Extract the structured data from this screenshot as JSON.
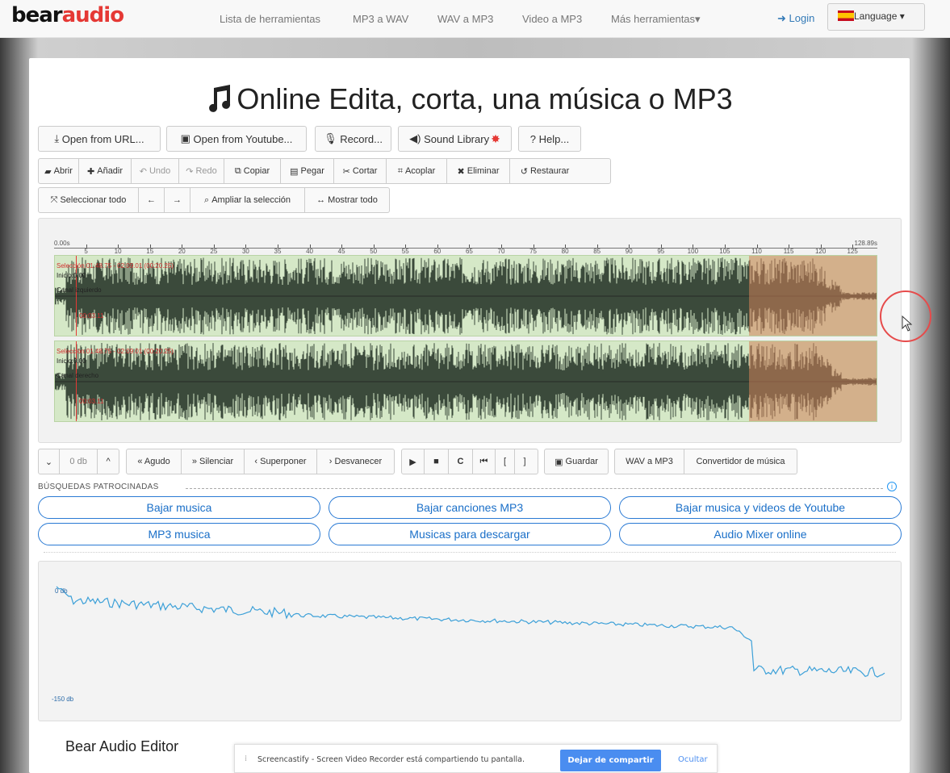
{
  "brand": {
    "part1": "bear",
    "part2": "audio"
  },
  "nav": {
    "items": [
      "Lista de herramientas",
      "MP3 a WAV",
      "WAV a MP3",
      "Video a MP3",
      "Más herramientas▾"
    ],
    "login": "Login",
    "language": "Language ▾"
  },
  "title": "Online Edita, corta, una música o MP3",
  "open_buttons": [
    "Open from URL...",
    "Open from Youtube...",
    "Record...",
    "Sound Library",
    "? Help..."
  ],
  "edit_toolbar": [
    "Abrir",
    "Añadir",
    "Undo",
    "Redo",
    "Copiar",
    "Pegar",
    "Cortar",
    "Acoplar",
    "Eliminar",
    "Restaurar"
  ],
  "select_toolbar": [
    "Seleccionar todo",
    "←",
    "→",
    "Ampliar la selección",
    "Mostrar todo"
  ],
  "timeline": {
    "start": "0.00s",
    "end": "128.89s",
    "ticks": [
      "5",
      "10",
      "15",
      "20",
      "25",
      "30",
      "35",
      "40",
      "45",
      "50",
      "55",
      "60",
      "65",
      "70",
      "75",
      "80",
      "85",
      "90",
      "95",
      "100",
      "105",
      "110",
      "115",
      "120",
      "125"
    ]
  },
  "channels": [
    {
      "selection": "Selección:01:48.75 - 02:09.01 (00:20.25)",
      "start": "Inicio:0.00",
      "name": "Canal izquierdo",
      "time": "00:03.11"
    },
    {
      "selection": "Selección:01:48.75 - 02:09.01 (00:20.25)",
      "start": "Inicio:0.00",
      "name": "Canal derecho",
      "time": "00:03.11"
    }
  ],
  "volume": {
    "down": "⌄",
    "value": "0 db",
    "up": "^"
  },
  "effects": [
    "« Agudo",
    "» Silenciar",
    "‹ Superponer",
    "› Desvanecer"
  ],
  "player": [
    "▶",
    "■",
    "C",
    "⏮",
    "[",
    "]"
  ],
  "save": "Guardar",
  "convert": [
    "WAV a MP3",
    "Convertidor de música"
  ],
  "sponsored_label": "BÚSQUEDAS PATROCINADAS",
  "sponsored_links": [
    [
      "Bajar musica",
      "Bajar canciones MP3",
      "Bajar musica y videos de Youtube"
    ],
    [
      "MP3 musica",
      "Musicas para descargar",
      "Audio Mixer online"
    ]
  ],
  "spectrum": {
    "top_label": "0 db",
    "bottom_label": "-150 db"
  },
  "footer_title": "Bear Audio Editor",
  "notification": {
    "message": "Screencastify - Screen Video Recorder está compartiendo tu pantalla.",
    "stop": "Dejar de compartir",
    "hide": "Ocultar"
  },
  "colors": {
    "accent": "#337ab7",
    "selection": "#d2825a",
    "wave_bg": "#d5e8c7",
    "wave": "#3b4a3b",
    "spectrum_line": "#3ca0d8"
  }
}
